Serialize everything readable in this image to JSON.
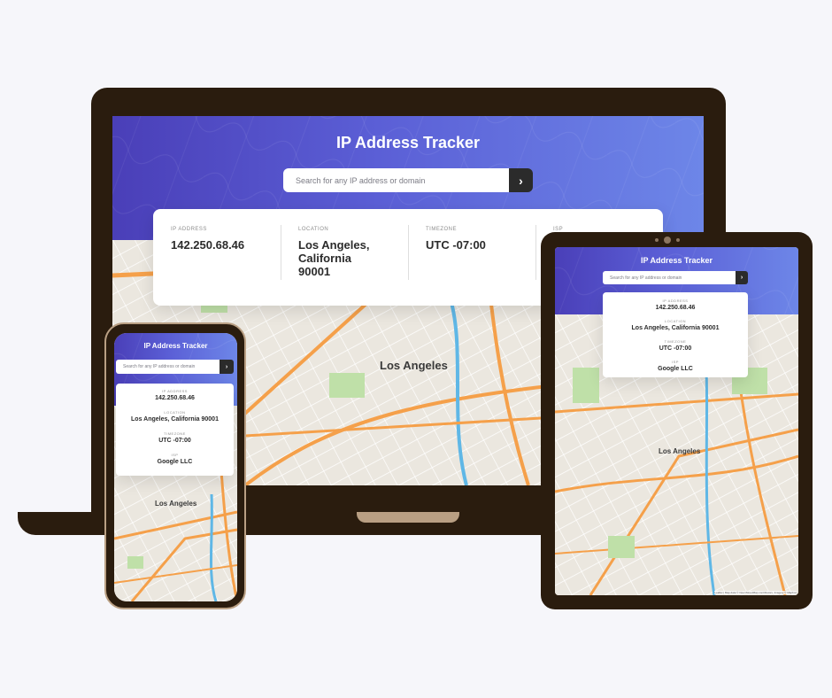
{
  "app": {
    "title": "IP Address Tracker",
    "search_placeholder": "Search for any IP address or domain",
    "submit_glyph": "›"
  },
  "labels": {
    "ip": "IP Address",
    "location": "Location",
    "timezone": "Timezone",
    "isp": "ISP"
  },
  "result": {
    "ip": "142.250.68.46",
    "location": "Los Angeles, California 90001",
    "location_lines": [
      "Los Angeles,",
      "California",
      "90001"
    ],
    "timezone": "UTC -07:00",
    "isp": "Google LLC"
  },
  "map": {
    "city_label": "Los Angeles",
    "attribution": "Leaflet | Map data © OpenStreetMap contributors, Imagery © Mapbox"
  },
  "colors": {
    "background": "#f6f6fa",
    "device_frame": "#2a1c0e",
    "header_start": "#4a3fb8",
    "header_end": "#6d86e8",
    "button": "#2b2b2b",
    "road_major": "#f5a04a",
    "freeway_blue": "#5fb7e6",
    "park": "#bfe0a8"
  }
}
